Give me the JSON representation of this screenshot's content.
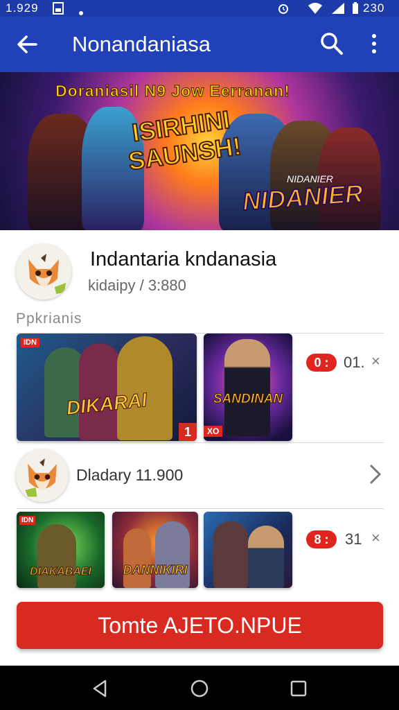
{
  "status_bar": {
    "time": "1.929",
    "right_text": "230"
  },
  "app_bar": {
    "title": "Nonandaniasa"
  },
  "hero": {
    "top_banner": "Doraniasil N9 Jow Eerranan!",
    "logo_left_line1": "ISIRHINI",
    "logo_left_line2": "SAUNSH!",
    "logo_right": "NIDANIER",
    "logo_right_small": "NIDANIER"
  },
  "channel": {
    "name": "Indantaria kndanasia",
    "subtitle": "kidaipy / 3:880"
  },
  "section_label": "Ppkrianis",
  "row1": {
    "card1": {
      "caption": "DIKARAI",
      "tag": "IDN",
      "corner_badge": "1"
    },
    "card2": {
      "caption": "SANDINAN",
      "tag": "XO"
    },
    "badge": "0 :",
    "count": "01.",
    "close": "×"
  },
  "channel2": {
    "name": "Dladary 11.900"
  },
  "row2": {
    "card1": {
      "caption": "DIAKABAEI",
      "tag": "IDN"
    },
    "card2": {
      "caption": "DANNIKIRI"
    },
    "badge": "8 :",
    "count": "31",
    "close": "×"
  },
  "cta": {
    "label": "Tomte AJETO.NPUE"
  },
  "colors": {
    "app_bar": "#2141b8",
    "accent": "#d92a22"
  }
}
